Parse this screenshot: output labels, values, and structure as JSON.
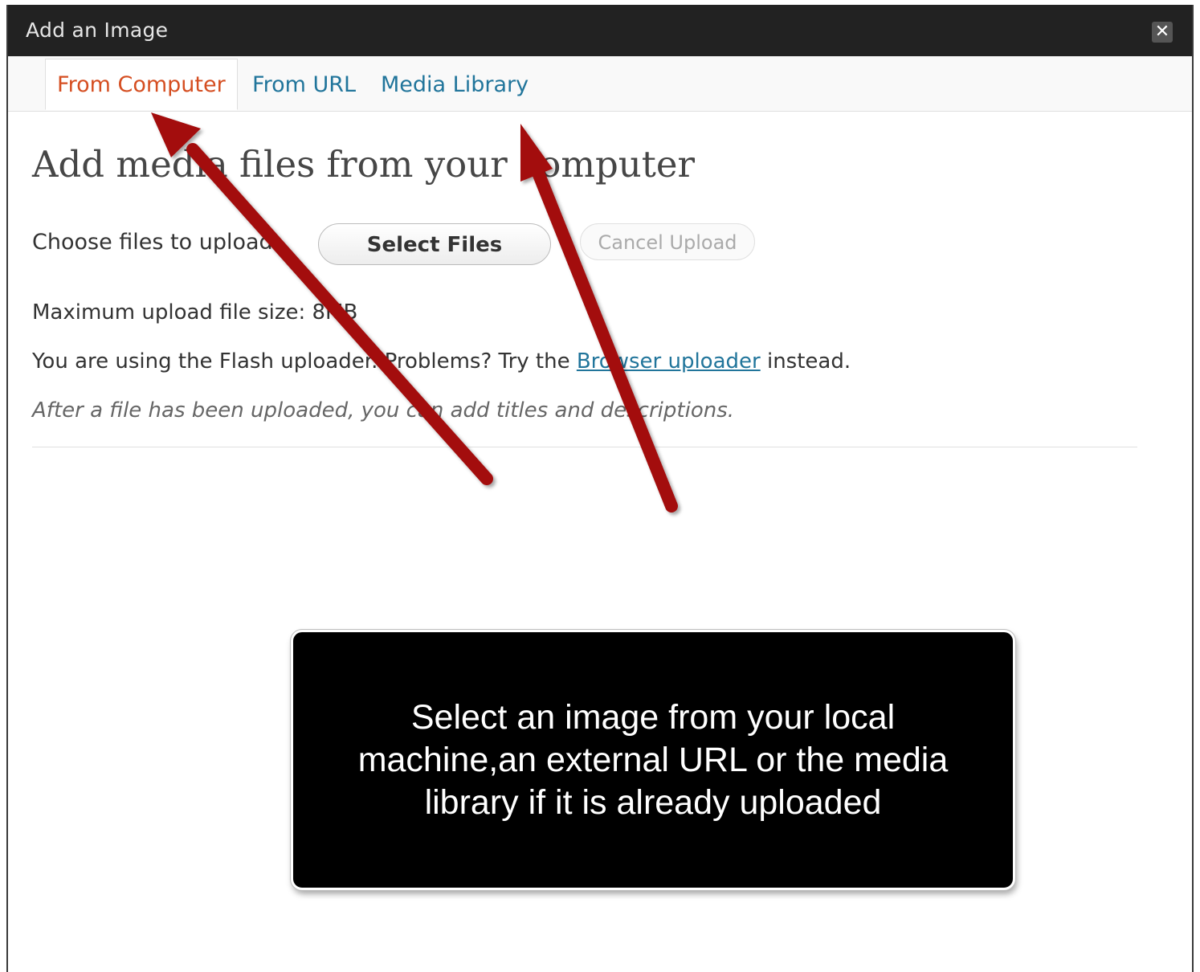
{
  "dialog": {
    "title": "Add an Image",
    "close_glyph": "✕"
  },
  "tabs": [
    {
      "label": "From Computer",
      "active": true
    },
    {
      "label": "From URL",
      "active": false
    },
    {
      "label": "Media Library",
      "active": false
    }
  ],
  "content": {
    "heading": "Add media files from your computer",
    "choose_label": "Choose files to upload",
    "select_button": "Select Files",
    "cancel_button": "Cancel Upload",
    "max_size": "Maximum upload file size: 8MB",
    "flash_prefix": "You are using the Flash uploader. Problems? Try the ",
    "flash_link": "Browser uploader",
    "flash_suffix": " instead.",
    "after_note": "After a file has been uploaded, you can add titles and descriptions."
  },
  "callout": {
    "text": "Select an image from your local machine,an external URL or the media library if it is already uploaded"
  },
  "colors": {
    "titlebar": "#222222",
    "tab_link": "#21759b",
    "tab_active": "#d54e21",
    "arrow": "#a30f0f"
  }
}
